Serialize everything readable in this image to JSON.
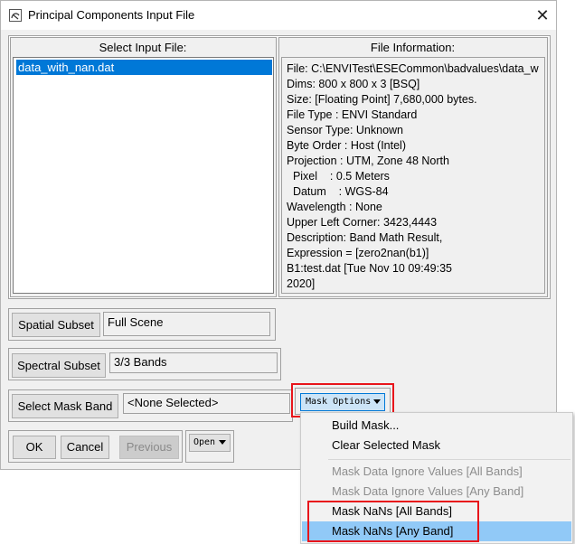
{
  "window": {
    "title": "Principal Components Input File",
    "close_glyph": "✕"
  },
  "select_input": {
    "label": "Select Input File:",
    "files": [
      "data_with_nan.dat"
    ]
  },
  "file_info": {
    "label": "File Information:",
    "lines": [
      "File: C:\\ENVITest\\ESECommon\\badvalues\\data_w",
      "Dims: 800 x 800 x 3 [BSQ]",
      "Size: [Floating Point] 7,680,000 bytes.",
      "File Type  : ENVI Standard",
      "Sensor Type: Unknown",
      "Byte Order : Host (Intel)",
      "Projection : UTM, Zone 48 North",
      "  Pixel    : 0.5 Meters",
      "  Datum    : WGS-84",
      "Wavelength : None",
      "Upper Left Corner: 3423,4443",
      "Description: Band Math Result,",
      "Expression = [zero2nan(b1)]",
      "B1:test.dat [Tue Nov 10 09:49:35",
      "2020]"
    ]
  },
  "spatial": {
    "button": "Spatial Subset",
    "value": "Full Scene"
  },
  "spectral": {
    "button": "Spectral Subset",
    "value": "3/3 Bands"
  },
  "mask": {
    "button": "Select Mask Band",
    "value": "<None Selected>",
    "options_button": "Mask Options"
  },
  "footer": {
    "ok": "OK",
    "cancel": "Cancel",
    "previous": "Previous",
    "open": "Open"
  },
  "mask_menu": {
    "items": [
      {
        "label": "Build Mask...",
        "enabled": true
      },
      {
        "label": "Clear Selected Mask",
        "enabled": true
      },
      {
        "label": "Mask Data Ignore Values [All Bands]",
        "enabled": false
      },
      {
        "label": "Mask Data Ignore Values [Any Band]",
        "enabled": false
      },
      {
        "label": "Mask NaNs [All Bands]",
        "enabled": true
      },
      {
        "label": "Mask NaNs [Any Band]",
        "enabled": true,
        "highlighted": true
      }
    ]
  },
  "colors": {
    "selection": "#0078d7",
    "menu_highlight": "#91c9f7",
    "annotation_red": "#e8151b"
  }
}
